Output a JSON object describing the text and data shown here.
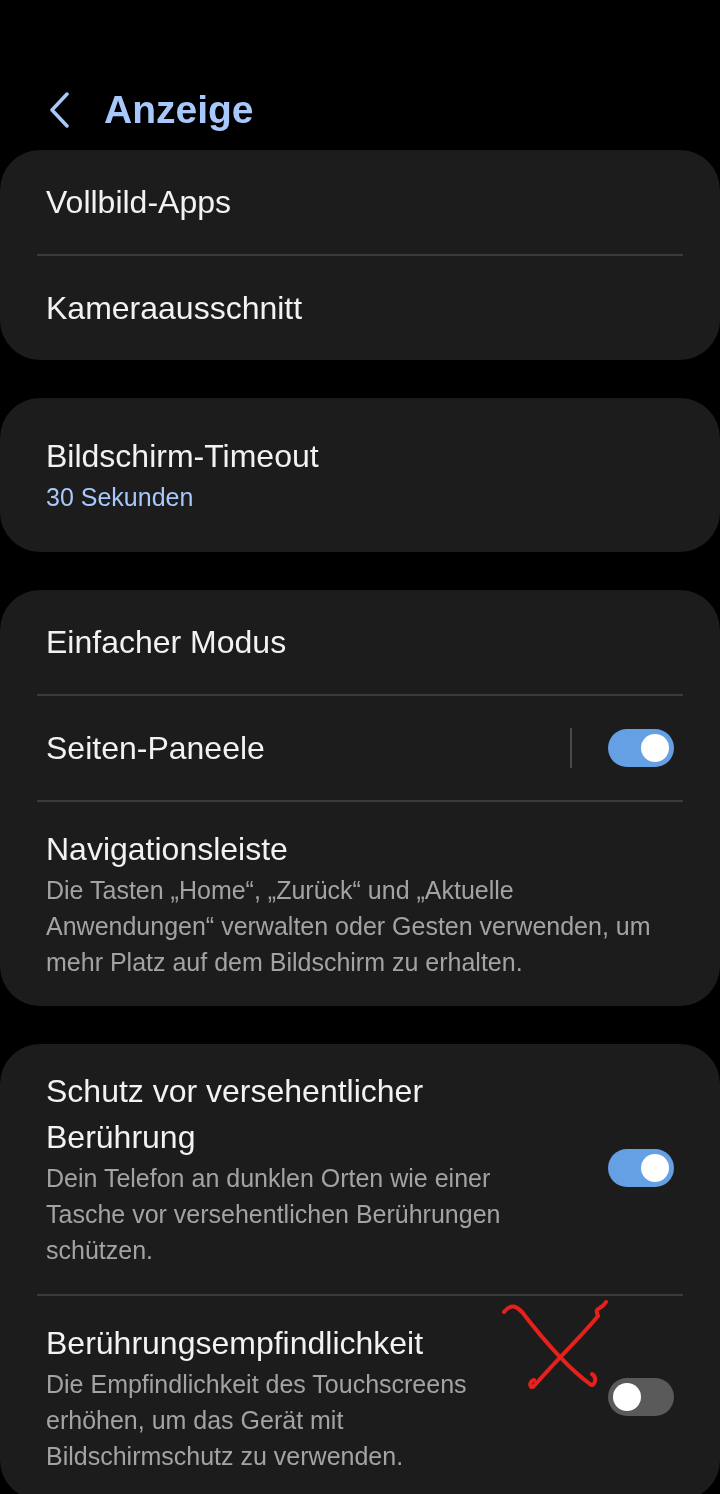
{
  "header": {
    "title": "Anzeige"
  },
  "groups": [
    {
      "items": [
        {
          "kind": "link",
          "title": "Vollbild-Apps"
        },
        {
          "kind": "link",
          "title": "Kameraausschnitt"
        }
      ]
    },
    {
      "items": [
        {
          "kind": "link",
          "title": "Bildschirm-Timeout",
          "value": "30 Sekunden"
        }
      ]
    },
    {
      "items": [
        {
          "kind": "link",
          "title": "Einfacher Modus"
        },
        {
          "kind": "split-toggle",
          "title": "Seiten-Paneele",
          "on": true
        },
        {
          "kind": "link",
          "title": "Navigationsleiste",
          "description": "Die Tasten „Home“, „Zurück“ und „Aktuelle Anwendungen“ verwalten oder Gesten verwenden, um mehr Platz auf dem Bildschirm zu erhalten."
        }
      ]
    },
    {
      "items": [
        {
          "kind": "toggle",
          "title": "Schutz vor versehentlicher Berührung",
          "description": "Dein Telefon an dunklen Orten wie einer Tasche vor versehentlichen Berührungen schützen.",
          "on": true
        },
        {
          "kind": "toggle",
          "title": "Berührungsempfindlichkeit",
          "description": "Die Empfindlichkeit des Touchscreens erhöhen, um das Gerät mit Bildschirmschutz zu verwenden.",
          "on": false
        }
      ]
    }
  ]
}
